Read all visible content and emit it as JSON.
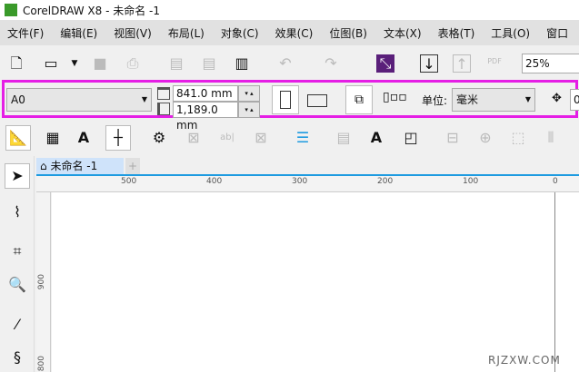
{
  "window": {
    "title": "CorelDRAW X8 - 未命名 -1"
  },
  "menu": [
    "文件(F)",
    "编辑(E)",
    "视图(V)",
    "布局(L)",
    "对象(C)",
    "效果(C)",
    "位图(B)",
    "文本(X)",
    "表格(T)",
    "工具(O)",
    "窗口"
  ],
  "standard_toolbar": {
    "zoom_value": "25%",
    "pdf_label": "PDF"
  },
  "property_bar": {
    "page_size": "A0",
    "width": "841.0 mm",
    "height": "1,189.0 mm",
    "units_label": "单位:",
    "units_value": "毫米",
    "nudge_partial": "0"
  },
  "document_tab": {
    "label": "未命名 -1",
    "add_label": "+"
  },
  "ruler": {
    "h_labels": [
      "500",
      "400",
      "300",
      "200",
      "100",
      "0"
    ],
    "v_labels": [
      "900",
      "800"
    ]
  },
  "watermark": "RJZXW.COM",
  "colors": {
    "highlight": "#e51ee5",
    "accent": "#1e9be0"
  }
}
